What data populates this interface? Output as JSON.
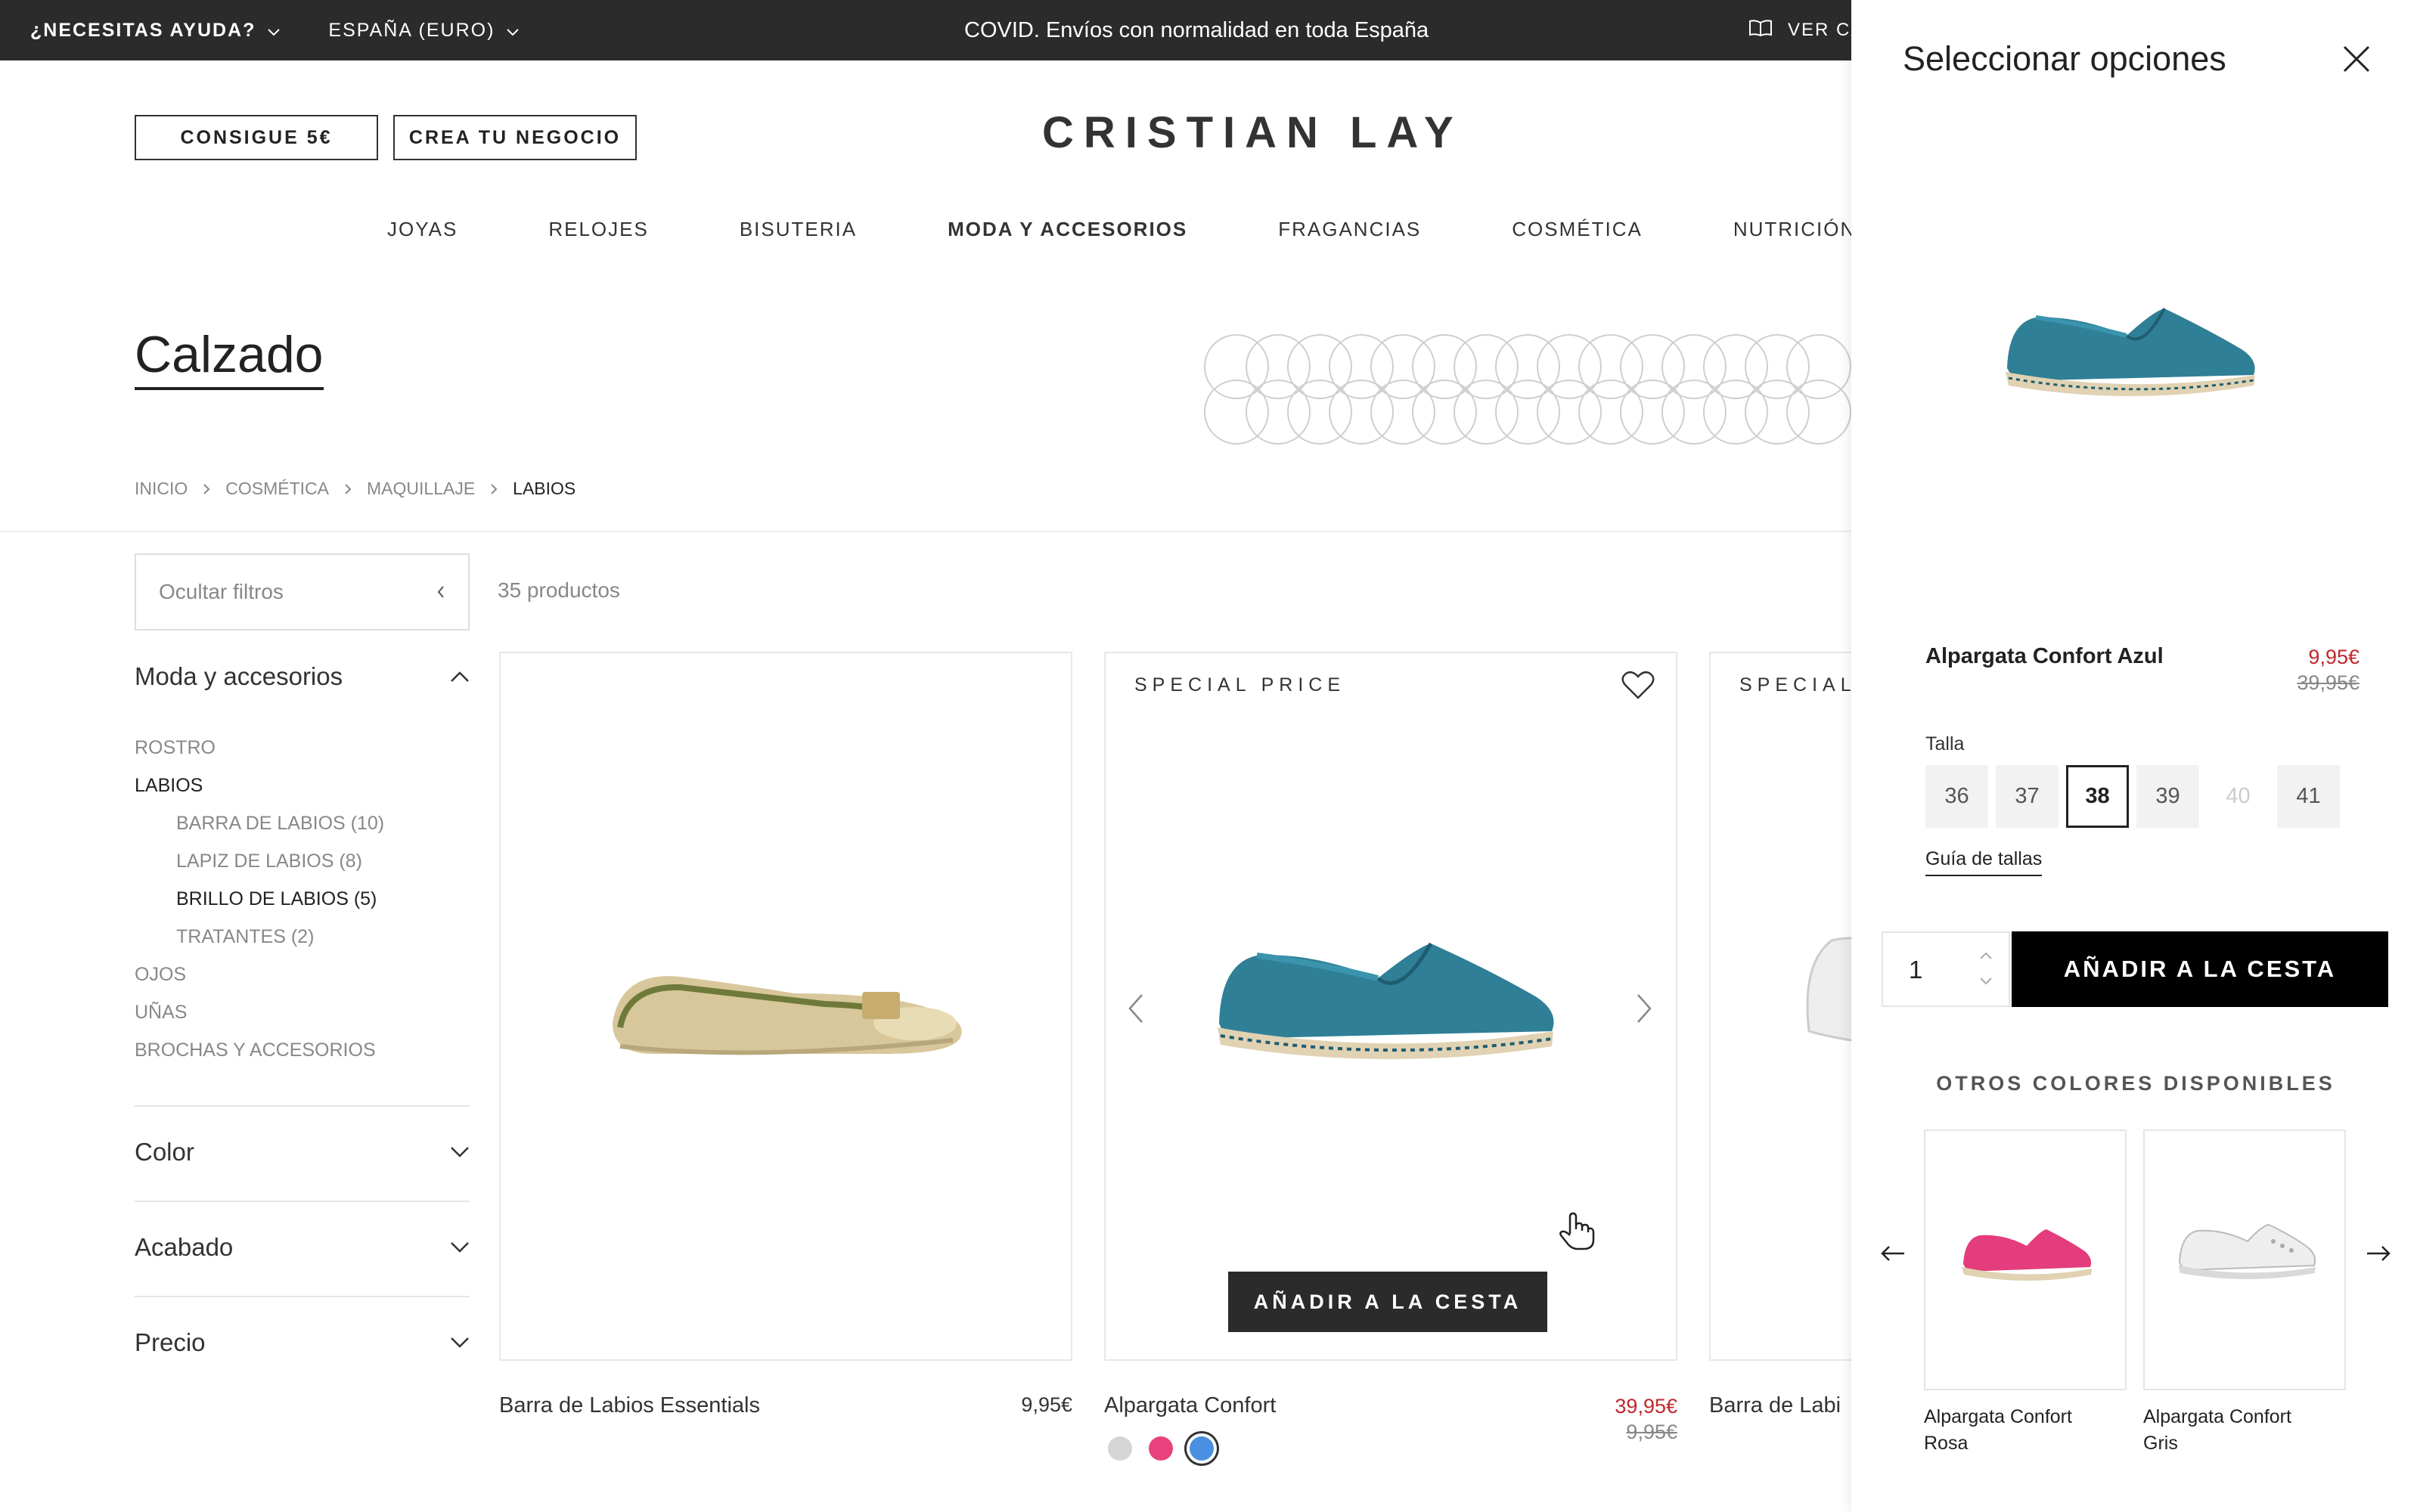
{
  "topbar": {
    "help": "¿NECESITAS AYUDA?",
    "region": "ESPAÑA (EURO)",
    "announcement": "COVID. Envíos con normalidad en toda España",
    "catalog": "VER CA"
  },
  "header": {
    "promo_button": "CONSIGUE 5€",
    "business_button": "CREA TU NEGOCIO",
    "brand": "CRISTIAN LAY"
  },
  "nav": [
    "JOYAS",
    "RELOJES",
    "BISUTERIA",
    "MODA Y ACCESORIOS",
    "FRAGANCIAS",
    "COSMÉTICA",
    "NUTRICIÓN"
  ],
  "nav_active": "MODA Y ACCESORIOS",
  "page_title": "Calzado",
  "breadcrumb": [
    "INICIO",
    "COSMÉTICA",
    "MAQUILLAJE",
    "LABIOS"
  ],
  "filters": {
    "toggle_label": "Ocultar filtros",
    "product_count": "35 productos",
    "category_heading": "Moda y accesorios",
    "category_items": [
      {
        "label": "ROSTRO"
      },
      {
        "label": "LABIOS"
      },
      {
        "label": "BARRA DE LABIOS (10)"
      },
      {
        "label": "LAPIZ DE LABIOS (8)"
      },
      {
        "label": "BRILLO DE LABIOS (5)"
      },
      {
        "label": "TRATANTES (2)"
      },
      {
        "label": "OJOS"
      },
      {
        "label": "UÑAS"
      },
      {
        "label": "BROCHAS Y ACCESORIOS"
      }
    ],
    "other_facets": [
      "Color",
      "Acabado",
      "Precio"
    ]
  },
  "products": [
    {
      "name": "Barra de Labios Essentials",
      "price": "9,95€",
      "tag": ""
    },
    {
      "name": "Alpargata Confort",
      "price": "39,95€",
      "old_price": "9,95€",
      "tag": "SPECIAL PRICE",
      "add_label": "AÑADIR A LA CESTA"
    },
    {
      "name": "Barra de Labi",
      "tag": "SPECIAL P"
    }
  ],
  "swatch_colors": [
    "#d5d5d5",
    "#e8427c",
    "#4a90e2"
  ],
  "panel": {
    "title": "Seleccionar opciones",
    "product_name": "Alpargata Confort Azul",
    "price": "9,95€",
    "old_price": "39,95€",
    "size_label": "Talla",
    "sizes": [
      "36",
      "37",
      "38",
      "39",
      "40",
      "41"
    ],
    "selected_size": "38",
    "disabled_size": "40",
    "size_guide": "Guía de tallas",
    "quantity": "1",
    "add_label": "AÑADIR A LA CESTA",
    "other_colors_heading": "OTROS COLORES DISPONIBLES",
    "other_colors": [
      "Alpargata Confort Rosa",
      "Alpargata Confort Gris"
    ]
  },
  "colors": {
    "sale": "#c0272d",
    "dark": "#2b2b2b",
    "espadrille_blue": "#2f7f96"
  }
}
